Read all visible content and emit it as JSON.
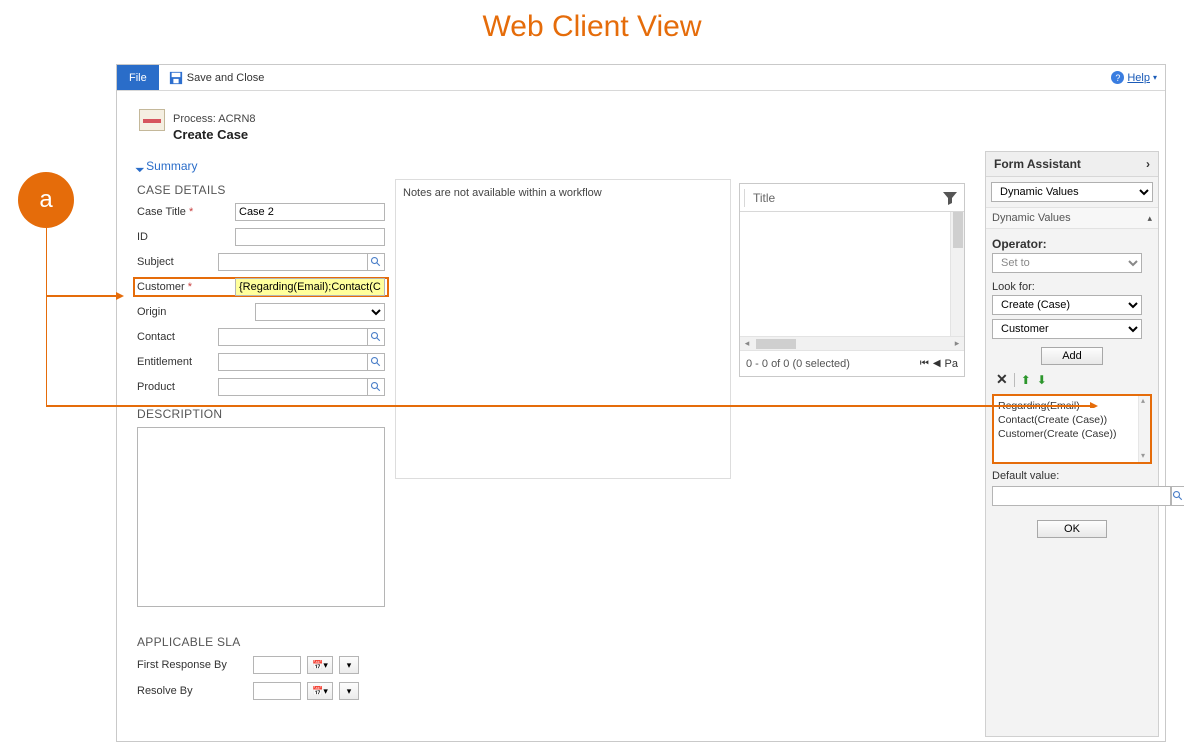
{
  "heading": "Web Client View",
  "topbar": {
    "file": "File",
    "save_close": "Save and Close",
    "help": "Help"
  },
  "process": {
    "line1": "Process: ACRN8",
    "line2": "Create Case"
  },
  "summary": "Summary",
  "sections": {
    "case_details": "CASE DETAILS",
    "description": "DESCRIPTION",
    "sla": "APPLICABLE SLA"
  },
  "fields": {
    "case_title": {
      "label": "Case Title",
      "value": "Case 2"
    },
    "id": {
      "label": "ID",
      "value": ""
    },
    "subject": {
      "label": "Subject",
      "value": ""
    },
    "customer": {
      "label": "Customer",
      "value": "{Regarding(Email);Contact(Cr"
    },
    "origin": {
      "label": "Origin",
      "value": ""
    },
    "contact": {
      "label": "Contact",
      "value": ""
    },
    "entitlement": {
      "label": "Entitlement",
      "value": ""
    },
    "product": {
      "label": "Product",
      "value": ""
    }
  },
  "sla": {
    "first": "First Response By",
    "resolve": "Resolve By"
  },
  "notes": "Notes are not available within a workflow",
  "grid": {
    "title_col": "Title",
    "status": "0 - 0 of 0 (0 selected)",
    "page": "Pa"
  },
  "assistant": {
    "title": "Form Assistant",
    "mode": "Dynamic Values",
    "sub": "Dynamic Values",
    "operator_lbl": "Operator:",
    "operator_val": "Set to",
    "look_for": "Look for:",
    "lf1": "Create (Case)",
    "lf2": "Customer",
    "add": "Add",
    "list": [
      "Regarding(Email)",
      "Contact(Create (Case))",
      "Customer(Create (Case))"
    ],
    "default_lbl": "Default value:",
    "ok": "OK"
  },
  "annotation": "a"
}
